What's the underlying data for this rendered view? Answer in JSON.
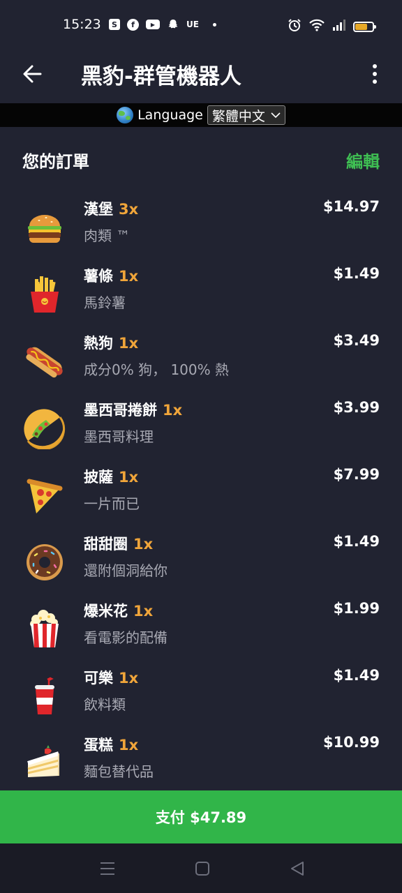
{
  "status": {
    "time": "15:23",
    "carrier": "UE",
    "battery_level": 0.7,
    "icons": [
      "shop-icon",
      "facebook-icon",
      "youtube-icon",
      "snapchat-icon"
    ]
  },
  "appbar": {
    "title": "黑豹-群管機器人"
  },
  "language": {
    "label": "Language",
    "selected": "繁體中文"
  },
  "order": {
    "title": "您的訂單",
    "edit_label": "編輯",
    "items": [
      {
        "name": "漢堡",
        "qty": "3x",
        "desc": "肉類 ™",
        "price": "$14.97",
        "icon": "burger-icon"
      },
      {
        "name": "薯條",
        "qty": "1x",
        "desc": "馬鈴薯",
        "price": "$1.49",
        "icon": "fries-icon"
      },
      {
        "name": "熱狗",
        "qty": "1x",
        "desc": "成分0% 狗， 100% 熱",
        "price": "$3.49",
        "icon": "hotdog-icon"
      },
      {
        "name": "墨西哥捲餅",
        "qty": "1x",
        "desc": "墨西哥料理",
        "price": "$3.99",
        "icon": "taco-icon"
      },
      {
        "name": "披薩",
        "qty": "1x",
        "desc": "一片而已",
        "price": "$7.99",
        "icon": "pizza-icon"
      },
      {
        "name": "甜甜圈",
        "qty": "1x",
        "desc": "還附個洞給你",
        "price": "$1.49",
        "icon": "donut-icon"
      },
      {
        "name": "爆米花",
        "qty": "1x",
        "desc": "看電影的配備",
        "price": "$1.99",
        "icon": "popcorn-icon"
      },
      {
        "name": "可樂",
        "qty": "1x",
        "desc": "飲料類",
        "price": "$1.49",
        "icon": "cola-icon"
      },
      {
        "name": "蛋糕",
        "qty": "1x",
        "desc": "麵包替代品",
        "price": "$10.99",
        "icon": "cake-icon"
      }
    ]
  },
  "pay_button": {
    "label": "支付 $47.89",
    "color": "#31b549"
  },
  "colors": {
    "background": "#212331",
    "accent": "#3fbf53",
    "quantity": "#f0a53a"
  }
}
